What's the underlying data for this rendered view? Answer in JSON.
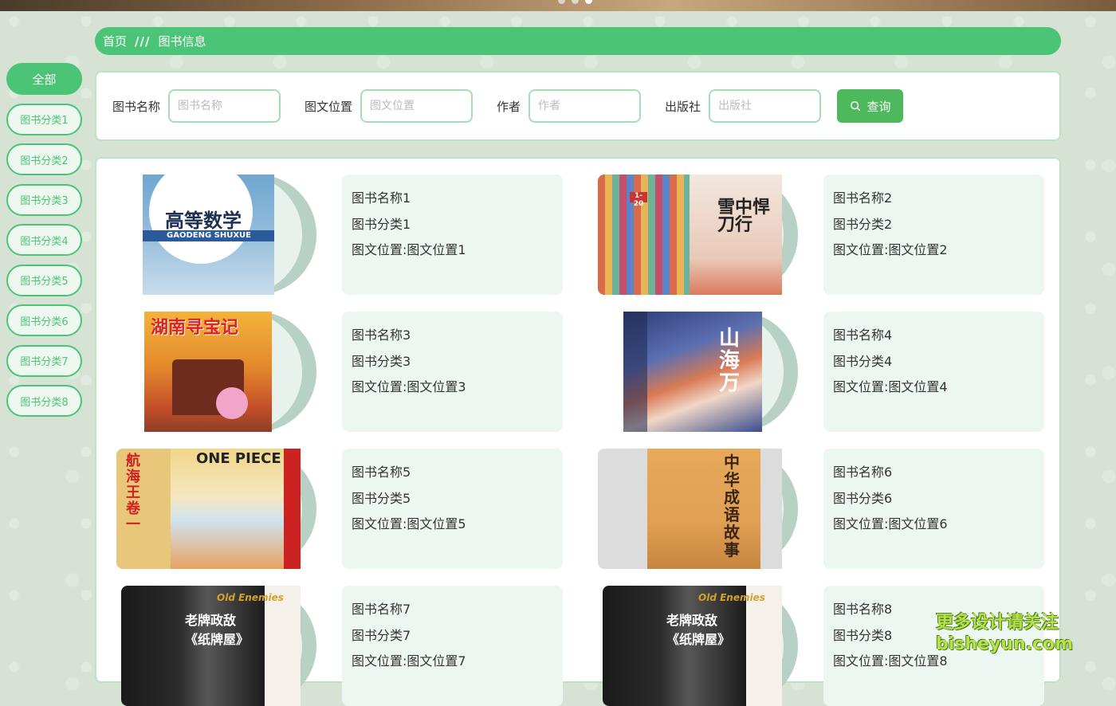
{
  "breadcrumb": {
    "home": "首页",
    "separator": "///",
    "current": "图书信息"
  },
  "sidebar": {
    "items": [
      {
        "label": "全部",
        "active": true
      },
      {
        "label": "图书分类1"
      },
      {
        "label": "图书分类2"
      },
      {
        "label": "图书分类3"
      },
      {
        "label": "图书分类4"
      },
      {
        "label": "图书分类5"
      },
      {
        "label": "图书分类6"
      },
      {
        "label": "图书分类7"
      },
      {
        "label": "图书分类8"
      }
    ]
  },
  "search": {
    "fields": [
      {
        "label": "图书名称",
        "placeholder": "图书名称",
        "value": ""
      },
      {
        "label": "图文位置",
        "placeholder": "图文位置",
        "value": ""
      },
      {
        "label": "作者",
        "placeholder": "作者",
        "value": ""
      },
      {
        "label": "出版社",
        "placeholder": "出版社",
        "value": ""
      }
    ],
    "button_label": "查询"
  },
  "books": [
    {
      "name": "图书名称1",
      "category": "图书分类1",
      "location": "图文位置:图文位置1",
      "cover_text": "高等数学",
      "cover_sub": "GAODENG SHUXUE"
    },
    {
      "name": "图书名称2",
      "category": "图书分类2",
      "location": "图文位置:图文位置2",
      "cover_text": "雪中悍刀行",
      "cover_sub": "1-20"
    },
    {
      "name": "图书名称3",
      "category": "图书分类3",
      "location": "图文位置:图文位置3",
      "cover_text": "湖南寻宝记",
      "cover_sub": ""
    },
    {
      "name": "图书名称4",
      "category": "图书分类4",
      "location": "图文位置:图文位置4",
      "cover_text": "山海万",
      "cover_sub": ""
    },
    {
      "name": "图书名称5",
      "category": "图书分类5",
      "location": "图文位置:图文位置5",
      "cover_text": "航海王 卷一",
      "cover_sub": "ONE PIECE"
    },
    {
      "name": "图书名称6",
      "category": "图书分类6",
      "location": "图文位置:图文位置6",
      "cover_text": "中华成语故事",
      "cover_sub": ""
    },
    {
      "name": "图书名称7",
      "category": "图书分类7",
      "location": "图文位置:图文位置7",
      "cover_text": "老牌政敌 《纸牌屋》",
      "cover_sub": "Old Enemies"
    },
    {
      "name": "图书名称8",
      "category": "图书分类8",
      "location": "图文位置:图文位置8",
      "cover_text": "老牌政敌 《纸牌屋》",
      "cover_sub": "Old Enemies"
    }
  ],
  "watermark": {
    "line1": "更多设计请关注",
    "line2": "bisheyun.com"
  },
  "colors": {
    "accent": "#4cc477",
    "button": "#4db85c",
    "card_bg": "#edf7f1"
  }
}
